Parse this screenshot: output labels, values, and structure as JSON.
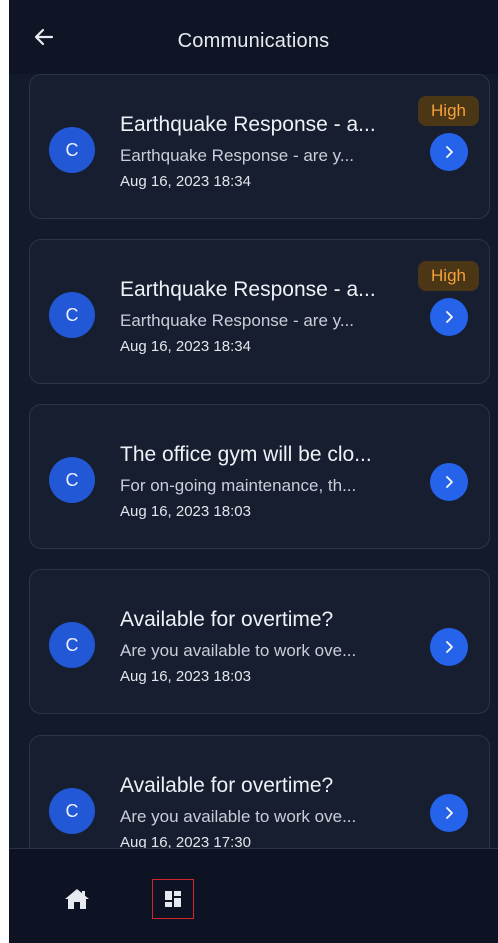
{
  "header": {
    "title": "Communications",
    "back_icon": "arrow-left-icon"
  },
  "messages": [
    {
      "avatar": "C",
      "title": "Earthquake Response - a...",
      "snippet": "Earthquake Response - are y...",
      "time": "Aug 16, 2023 18:34",
      "priority": "High"
    },
    {
      "avatar": "C",
      "title": "Earthquake Response - a...",
      "snippet": "Earthquake Response - are y...",
      "time": "Aug 16, 2023 18:34",
      "priority": "High"
    },
    {
      "avatar": "C",
      "title": "The office gym will be clo...",
      "snippet": "For on-going maintenance, th...",
      "time": "Aug 16, 2023 18:03",
      "priority": ""
    },
    {
      "avatar": "C",
      "title": "Available for overtime?",
      "snippet": "Are you available to work ove...",
      "time": "Aug 16, 2023 18:03",
      "priority": ""
    },
    {
      "avatar": "C",
      "title": "Available for overtime?",
      "snippet": "Are you available to work ove...",
      "time": "Aug 16, 2023 17:30",
      "priority": ""
    }
  ],
  "bottom_nav": {
    "items": [
      {
        "icon": "home-icon"
      },
      {
        "icon": "dashboard-icon"
      }
    ]
  },
  "colors": {
    "background": "#131a2b",
    "card": "#161e30",
    "accent": "#2563eb",
    "priority_text": "#f6a13a"
  }
}
